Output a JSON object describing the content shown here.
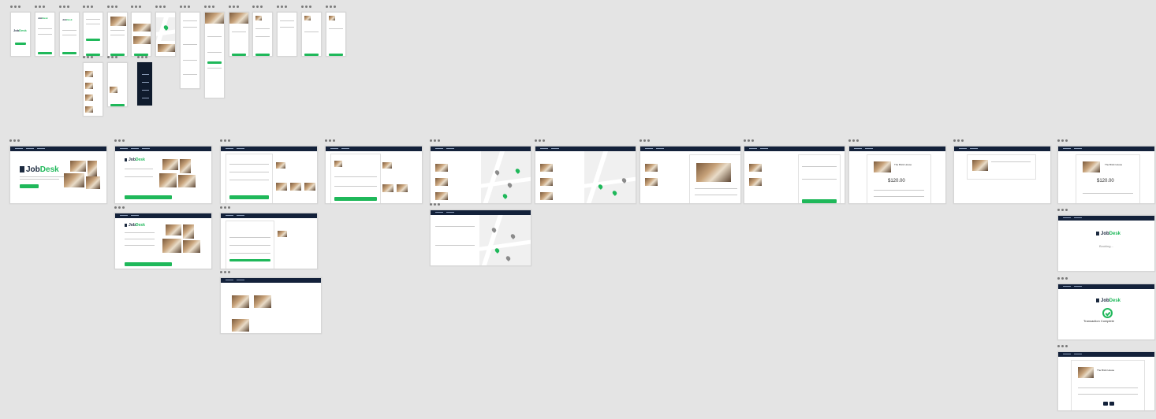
{
  "canvas": {
    "background": "#e4e4e4",
    "accent": "#1fb85a",
    "navy": "#13213a"
  },
  "brand": {
    "name_part1": "Job",
    "name_part2": "Desk"
  },
  "desktop": {
    "home": {
      "cta_label": "Get started"
    },
    "pricing": {
      "amount": "$120.00",
      "venue": "The Brick House"
    },
    "loading": {
      "status": "Booking..."
    },
    "complete": {
      "status": "Transaction Complete"
    }
  },
  "icons": {
    "window_dots": "window-dots-icon",
    "map_pin": "map-pin-icon",
    "check": "check-circle-icon",
    "logo_mark": "logo-mark-icon"
  }
}
